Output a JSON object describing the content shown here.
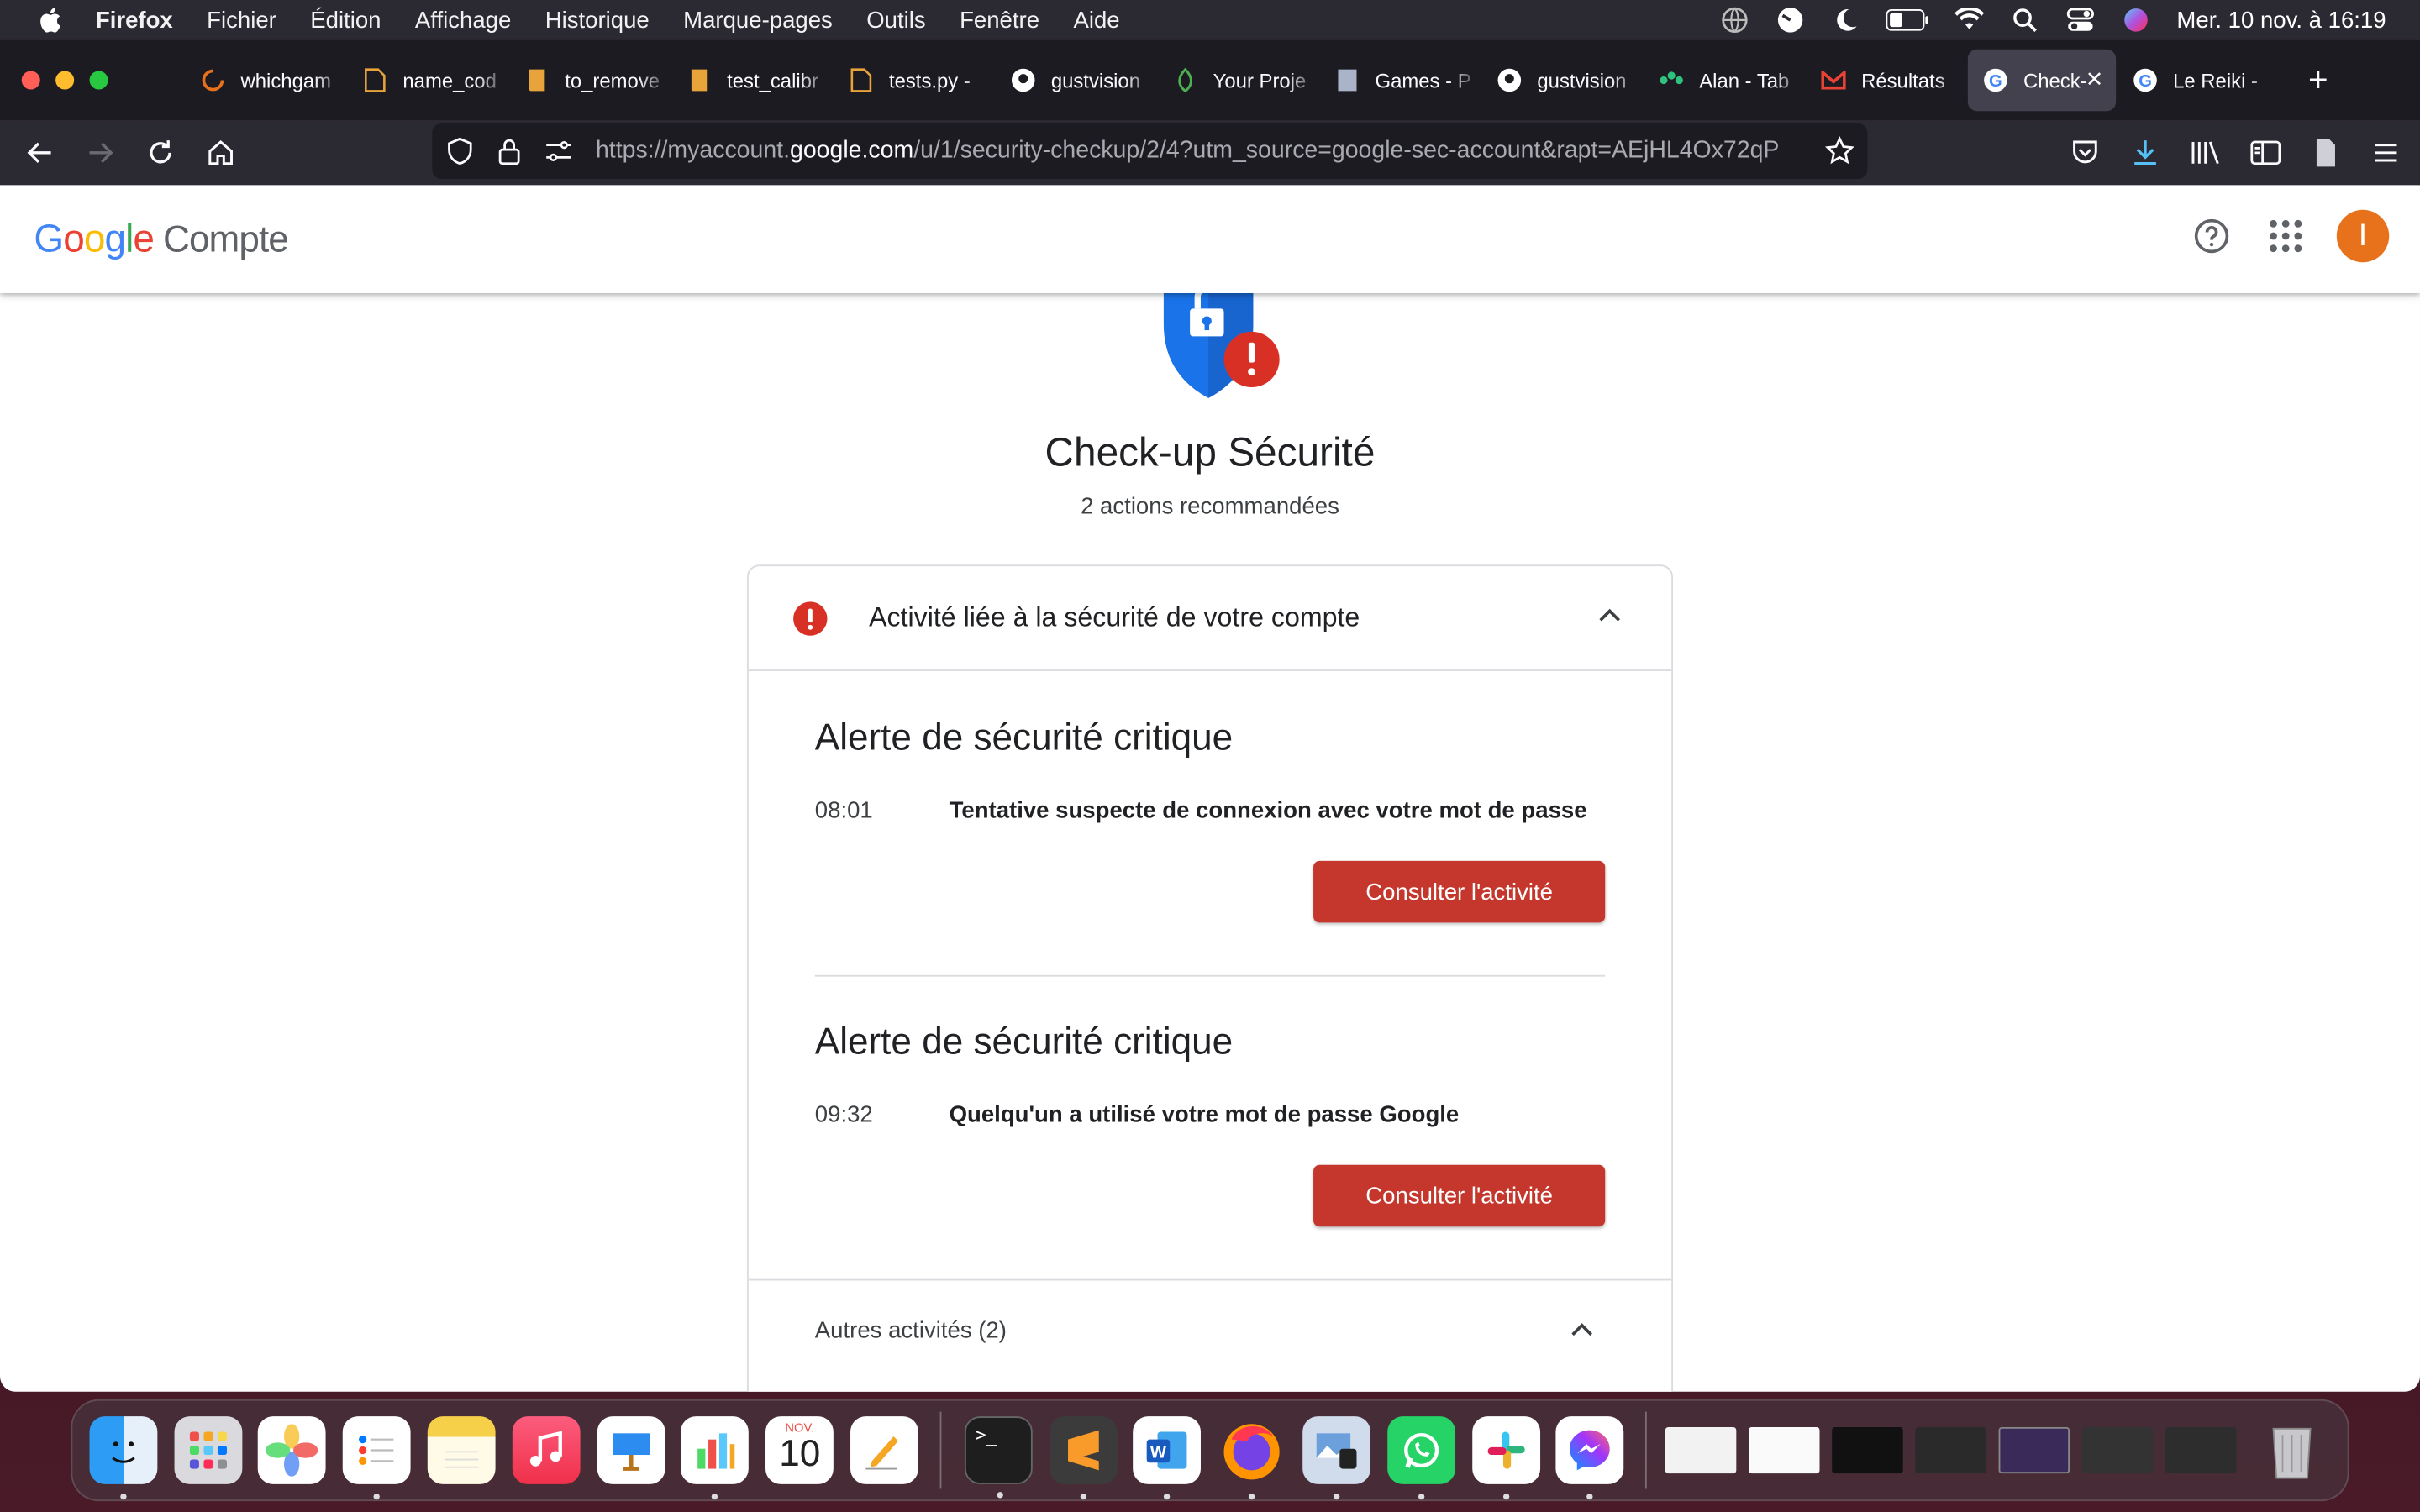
{
  "menubar": {
    "items": [
      "Firefox",
      "Fichier",
      "Édition",
      "Affichage",
      "Historique",
      "Marque-pages",
      "Outils",
      "Fenêtre",
      "Aide"
    ],
    "clock": "Mer. 10 nov. à  16:19"
  },
  "tabs": [
    {
      "label": "whichgam",
      "icon": "loading-icon",
      "color": "#e8711c"
    },
    {
      "label": "name_cod",
      "icon": "file-icon",
      "color": "#e8a33a"
    },
    {
      "label": "to_remove",
      "icon": "book-icon",
      "color": "#e8a33a"
    },
    {
      "label": "test_calibr",
      "icon": "book-icon",
      "color": "#e8a33a"
    },
    {
      "label": "tests.py -",
      "icon": "file-icon",
      "color": "#e8a33a"
    },
    {
      "label": "gustvision",
      "icon": "github-icon",
      "color": "#ffffff"
    },
    {
      "label": "Your Proje",
      "icon": "leaf-icon",
      "color": "#4caf50"
    },
    {
      "label": "Games - P",
      "icon": "doc-icon",
      "color": "#aab4c8"
    },
    {
      "label": "gustvision",
      "icon": "github-icon",
      "color": "#ffffff"
    },
    {
      "label": "Alan - Tab",
      "icon": "alan-icon",
      "color": "#2ec27e"
    },
    {
      "label": "Résultats",
      "icon": "gmail-icon",
      "color": "#ea4335"
    },
    {
      "label": "Check-",
      "icon": "google-icon",
      "color": "#4285f4",
      "active": true
    },
    {
      "label": "Le Reiki -",
      "icon": "google-icon",
      "color": "#4285f4"
    }
  ],
  "urlbar": {
    "prefix": "https://myaccount.",
    "domain": "google.com",
    "suffix": "/u/1/security-checkup/2/4?utm_source=google-sec-account&rapt=AEjHL4Ox72qP"
  },
  "header": {
    "logo": "Google",
    "product": "Compte",
    "avatar_letter": "I"
  },
  "checkup": {
    "title": "Check-up Sécurité",
    "subtitle": "2 actions recommandées"
  },
  "card": {
    "heading": "Activité liée à la sécurité de votre compte",
    "alerts": [
      {
        "title": "Alerte de sécurité critique",
        "time": "08:01",
        "description": "Tentative suspecte de connexion avec votre mot de passe",
        "button": "Consulter l'activité"
      },
      {
        "title": "Alerte de sécurité critique",
        "time": "09:32",
        "description": "Quelqu'un a utilisé votre mot de passe Google",
        "button": "Consulter l'activité"
      }
    ],
    "other": "Autres activités (2)"
  },
  "dock": {
    "calendar_month": "NOV.",
    "calendar_day": "10"
  },
  "colors": {
    "alert_red": "#c5372c",
    "icon_red": "#d93025",
    "shield_blue": "#1a73e8",
    "avatar": "#e8711c"
  }
}
